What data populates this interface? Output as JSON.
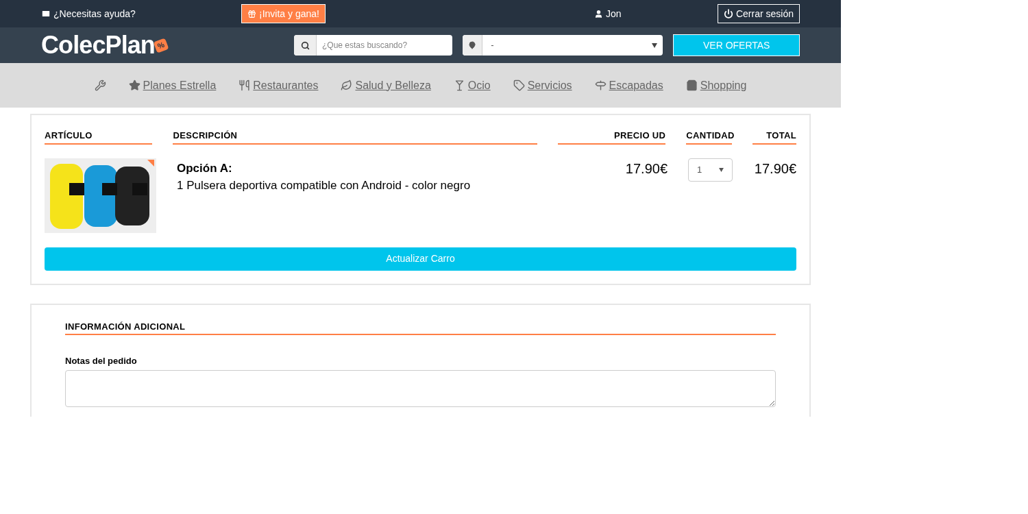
{
  "top_bar": {
    "help": "¿Necesitas ayuda?",
    "invite": "¡Invita y gana!",
    "user": "Jon",
    "logout": "Cerrar sesión"
  },
  "header": {
    "logo": "ColecPlan",
    "logo_tag": "%",
    "search": {
      "placeholder": "¿Que estas buscando?"
    },
    "location": {
      "value": "-"
    },
    "offers_button": "VER OFERTAS"
  },
  "nav": [
    {
      "kind": "icon"
    },
    {
      "label": "Planes Estrella"
    },
    {
      "label": "Restaurantes"
    },
    {
      "label": "Salud y Belleza"
    },
    {
      "label": "Ocio"
    },
    {
      "label": "Servicios"
    },
    {
      "label": "Escapadas"
    },
    {
      "label": "Shopping"
    }
  ],
  "cart": {
    "columns": [
      "ARTÍCULO",
      "DESCRIPCIÓN",
      "PRECIO UD",
      "CANTIDAD",
      "TOTAL"
    ],
    "rows": [
      {
        "option": "Opción A:",
        "description": "1 Pulsera deportiva compatible con Android - color negro",
        "price": "17.90€",
        "quantity": "1",
        "total": "17.90€"
      }
    ],
    "update_button": "Actualizar Carro"
  },
  "additional": {
    "title": "INFORMACIÓN ADICIONAL",
    "notes_label": "Notas del pedido"
  }
}
